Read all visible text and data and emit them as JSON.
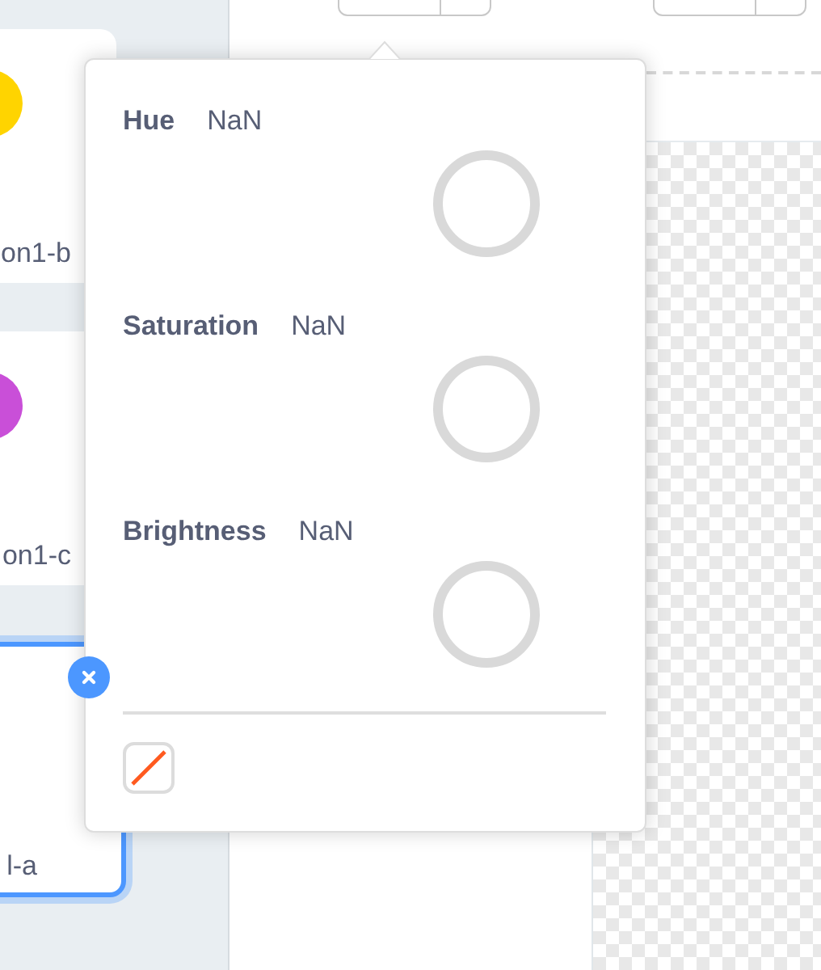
{
  "costumes": [
    {
      "name": "on1-b",
      "color": "#ffd400",
      "selected": false
    },
    {
      "name": "on1-c",
      "color": "#c94fd8",
      "selected": false
    },
    {
      "name": "l-a",
      "selected": true
    }
  ],
  "color_popover": {
    "sliders": [
      {
        "label": "Hue",
        "value": "NaN"
      },
      {
        "label": "Saturation",
        "value": "NaN"
      },
      {
        "label": "Brightness",
        "value": "NaN"
      }
    ],
    "swatch": {
      "kind": "none"
    }
  }
}
